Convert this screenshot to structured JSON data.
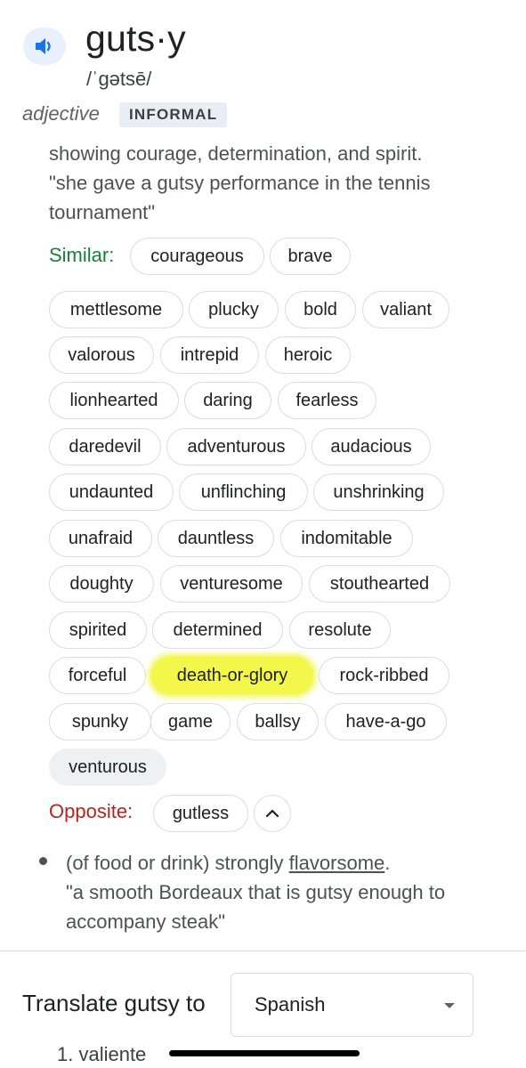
{
  "entry": {
    "word": "guts·y",
    "pronunciation": "/ˈɡətsē/",
    "part_of_speech": "adjective",
    "register": "INFORMAL",
    "speaker_icon": "speaker-icon"
  },
  "sense1": {
    "definition": "showing courage, determination, and spirit.",
    "example": "\"she gave a gutsy performance in the tennis tournament\""
  },
  "similar": {
    "label": "Similar:",
    "words": [
      "courageous",
      "brave",
      "mettlesome",
      "plucky",
      "bold",
      "valiant",
      "valorous",
      "intrepid",
      "heroic",
      "lionhearted",
      "daring",
      "fearless",
      "daredevil",
      "adventurous",
      "audacious",
      "undaunted",
      "unflinching",
      "unshrinking",
      "unafraid",
      "dauntless",
      "indomitable",
      "doughty",
      "venturesome",
      "stouthearted",
      "spirited",
      "determined",
      "resolute",
      "forceful",
      "death-or-glory",
      "rock-ribbed",
      "spunky",
      "game",
      "ballsy",
      "have-a-go",
      "venturous"
    ],
    "highlighted": "death-or-glory",
    "highlight_color": "#f2f74a"
  },
  "opposite": {
    "label": "Opposite:",
    "words": [
      "gutless"
    ],
    "expand_icon": "chevron-up-icon"
  },
  "sense2": {
    "prefix": "(of food or drink) strongly ",
    "link": "flavorsome",
    "suffix": ".",
    "example": "\"a smooth Bordeaux that is gutsy enough to accompany steak\""
  },
  "translate": {
    "label": "Translate gutsy to",
    "language": "Spanish",
    "results": [
      "1. valiente"
    ]
  },
  "colors": {
    "similar_label": "#188038",
    "opposite_label": "#b3261e",
    "speaker_accent": "#1a73e8"
  }
}
